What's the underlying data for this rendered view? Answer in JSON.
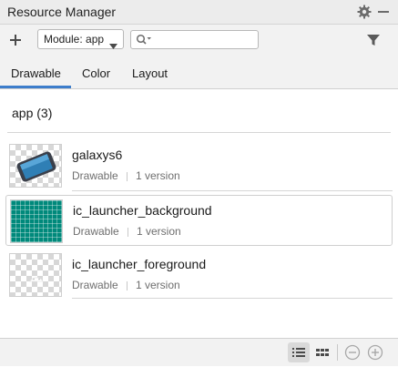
{
  "window": {
    "title": "Resource Manager"
  },
  "toolbar": {
    "module_label": "Module: app",
    "search_placeholder": ""
  },
  "tabs": [
    {
      "label": "Drawable",
      "selected": true
    },
    {
      "label": "Color",
      "selected": false
    },
    {
      "label": "Layout",
      "selected": false
    }
  ],
  "group": {
    "title": "app (3)"
  },
  "resources": [
    {
      "name": "galaxys6",
      "type": "Drawable",
      "versions": "1 version",
      "selected": false
    },
    {
      "name": "ic_launcher_background",
      "type": "Drawable",
      "versions": "1 version",
      "selected": true
    },
    {
      "name": "ic_launcher_foreground",
      "type": "Drawable",
      "versions": "1 version",
      "selected": false
    }
  ],
  "colors": {
    "accent": "#3d7dcb",
    "launcher_bg": "#00897b"
  },
  "icons": [
    "gear-icon",
    "minimize-icon",
    "add-icon",
    "chevron-down-icon",
    "search-icon",
    "filter-icon",
    "list-view-icon",
    "grid-view-icon",
    "zoom-out-icon",
    "zoom-in-icon"
  ]
}
